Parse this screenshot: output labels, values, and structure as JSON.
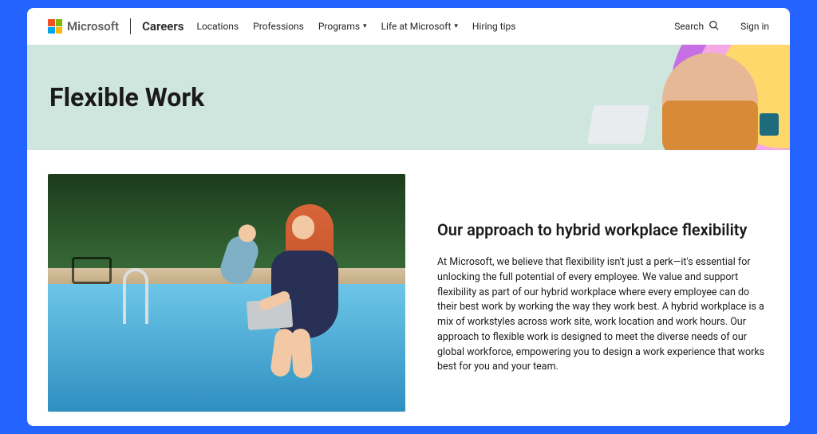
{
  "header": {
    "brand": "Microsoft",
    "careers": "Careers",
    "nav": {
      "locations": "Locations",
      "professions": "Professions",
      "programs": "Programs",
      "life": "Life at Microsoft",
      "tips": "Hiring tips"
    },
    "search": "Search",
    "signin": "Sign in"
  },
  "hero": {
    "title": "Flexible Work"
  },
  "main": {
    "heading": "Our approach to hybrid workplace flexibility",
    "body": "At Microsoft, we believe that flexibility isn't just a perk—it's essential for unlocking the full potential of every employee. We value and support flexibility as part of our hybrid workplace where every employee can do their best work by working the way they work best. A hybrid workplace is a mix of workstyles across work site, work location and work hours. Our approach to flexible work is designed to meet the diverse needs of our global workforce, empowering you to design a work experience that works best for you and your team."
  }
}
